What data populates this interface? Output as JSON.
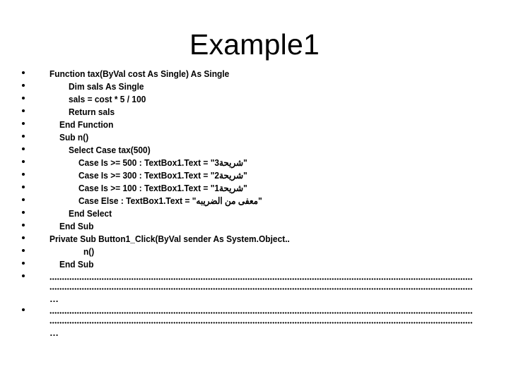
{
  "slide": {
    "title": "Example1",
    "code_lines": [
      {
        "text": "Function tax(ByVal cost As Single) As Single"
      },
      {
        "text": "Dim sals As Single"
      },
      {
        "text": "sals = cost * 5 / 100"
      },
      {
        "text": "Return sals"
      },
      {
        "text": "End Function"
      },
      {
        "text": "Sub n()"
      },
      {
        "text": "Select Case tax(500)"
      },
      {
        "prefix": "Case Is >= 500 : TextBox1.Text = \"",
        "arabic": "شريحة3",
        "suffix": "\""
      },
      {
        "prefix": "Case Is >= 300 : TextBox1.Text = \"",
        "arabic": "شريحة2",
        "suffix": "\""
      },
      {
        "prefix": "Case Is >= 100 : TextBox1.Text = \"",
        "arabic": "شريحة1",
        "suffix": "\""
      },
      {
        "prefix": "Case Else : TextBox1.Text = \"",
        "arabic": "معفى من الضريبه",
        "suffix": "\""
      },
      {
        "text": "End Select"
      },
      {
        "text": "End Sub"
      },
      {
        "text": "Private Sub Button1_Click(ByVal sender As System.Object.."
      },
      {
        "text": "n()"
      },
      {
        "text": "End Sub"
      }
    ],
    "placeholder_ellipsis": "…"
  }
}
